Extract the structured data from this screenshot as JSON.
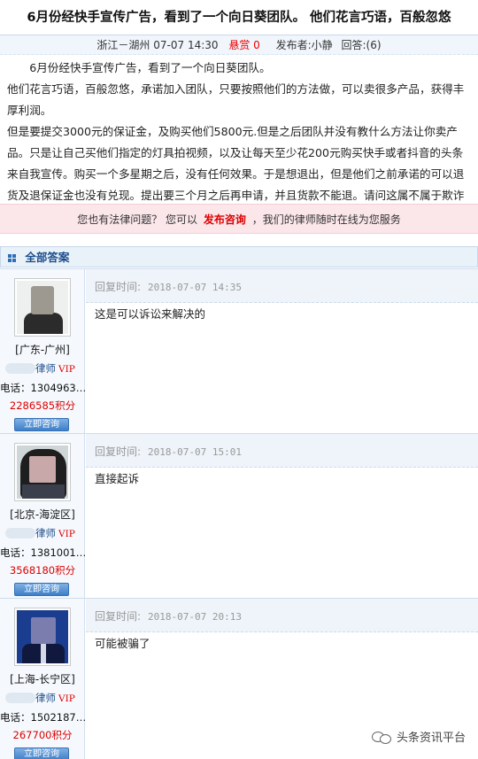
{
  "question": {
    "title": "6月份经快手宣传广告，看到了一个向日葵团队。 他们花言巧语，百般忽悠",
    "meta": {
      "location": "浙江－湖州",
      "time": "07-07 14:30",
      "reward": "悬赏 0",
      "author": "发布者:小静",
      "answers": "回答:(6)"
    },
    "paragraphs": [
      "6月份经快手宣传广告，看到了一个向日葵团队。",
      "他们花言巧语，百般忽悠，承诺加入团队，只要按照他们的方法做，可以卖很多产品，获得丰厚利润。",
      "但是要提交3000元的保证金，及购买他们5800元.但是之后团队并没有教什么方法让你卖产品。只是让自己买他们指定的灯具拍视频，以及让每天至少花200元购买快手或者抖音的头条来自我宣传。购买一个多星期之后，没有任何效果。于是想退出，但是他们之前承诺的可以退货及退保证金也没有兑现。提出要三个月之后再申请，并且货款不能退。请问这属不属于欺诈其行为"
    ]
  },
  "promo": {
    "prefix": "您也有法律问题？  您可以",
    "link": "发布咨询",
    "suffix": "，我们的律师随时在线为您服务"
  },
  "answers_section": {
    "title": "全部答案"
  },
  "answers": [
    {
      "region": "[广东-广州]",
      "role": "律师",
      "vip": "VIP",
      "phone": "电话：1304963…",
      "points": "2286585积分",
      "consult": "立即咨询",
      "reply_label": "回复时间:",
      "reply_time": "2018-07-07 14:35",
      "reply_text": "这是可以诉讼来解决的"
    },
    {
      "region": "[北京-海淀区]",
      "role": "律师",
      "vip": "VIP",
      "phone": "电话：1381001…",
      "points": "3568180积分",
      "consult": "立即咨询",
      "reply_label": "回复时间:",
      "reply_time": "2018-07-07 15:01",
      "reply_text": "直接起诉"
    },
    {
      "region": "[上海-长宁区]",
      "role": "律师",
      "vip": "VIP",
      "phone": "电话：1502187…",
      "points": "267700积分",
      "consult": "立即咨询",
      "reply_label": "回复时间:",
      "reply_time": "2018-07-07 20:13",
      "reply_text": "可能被骗了"
    }
  ],
  "watermark": {
    "icon": "wechat-icon",
    "text": "头条资讯平台"
  }
}
